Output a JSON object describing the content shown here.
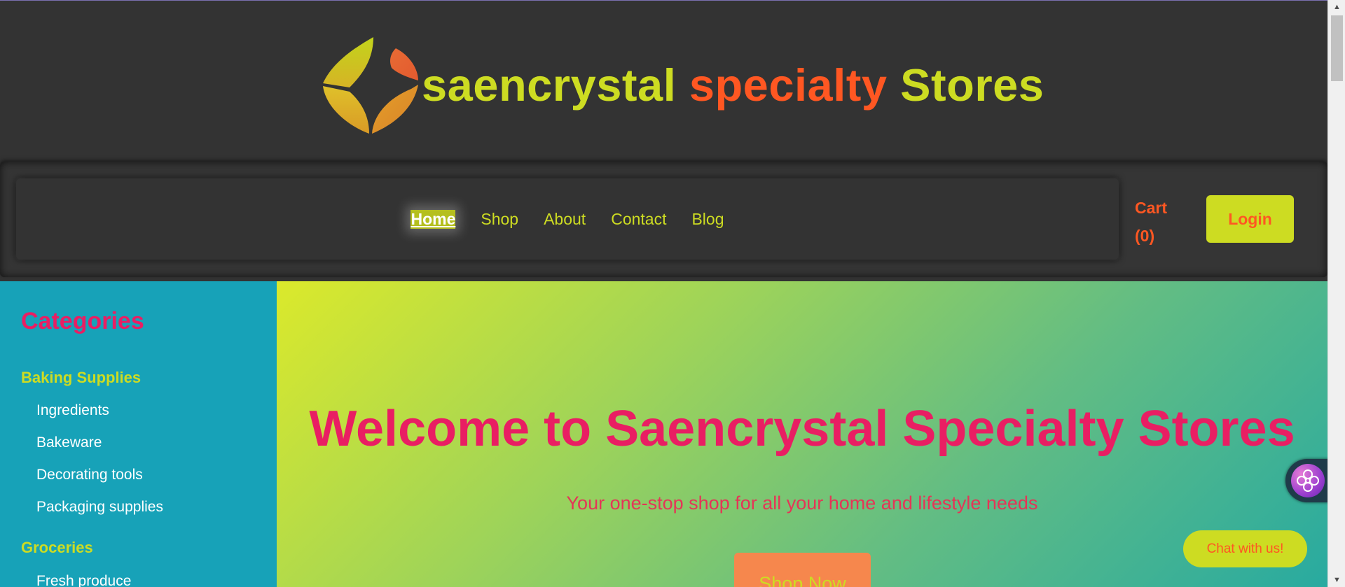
{
  "header": {
    "brand_part1": "saencrystal",
    "brand_part2": "specialty",
    "brand_part3": "Stores",
    "logo_icon": "leaf-petals-logo"
  },
  "nav": {
    "links": [
      "Home",
      "Shop",
      "About",
      "Contact",
      "Blog"
    ],
    "active": "Home",
    "cart_label": "Cart",
    "cart_count": "(0)",
    "login_label": "Login"
  },
  "sidebar": {
    "title": "Categories",
    "groups": [
      {
        "label": "Baking Supplies",
        "items": [
          "Ingredients",
          "Bakeware",
          "Decorating tools",
          "Packaging supplies"
        ]
      },
      {
        "label": "Groceries",
        "items": [
          "Fresh produce"
        ]
      }
    ]
  },
  "hero": {
    "title": "Welcome to Saencrystal Specialty Stores",
    "subtitle": "Your one-stop shop for all your home and lifestyle needs",
    "cta_label": "Shop Now"
  },
  "widgets": {
    "chat_label": "Chat with us!",
    "assistant_icon": "assistant-orb-icon"
  },
  "colors": {
    "background": "#333333",
    "accent_lime": "#cddc22",
    "accent_orange": "#ff5722",
    "accent_pink": "#e91e63",
    "sidebar_teal": "#17a2b8"
  }
}
